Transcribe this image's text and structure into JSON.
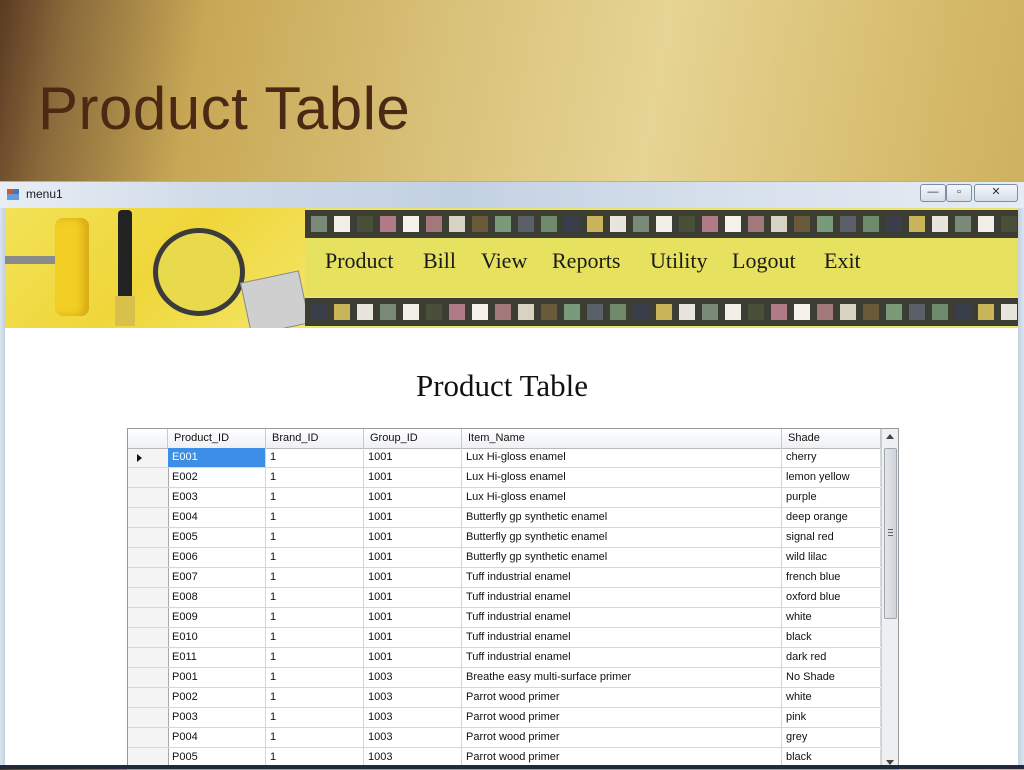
{
  "slide": {
    "title": "Product Table"
  },
  "window": {
    "title": "menu1",
    "controls": {
      "minimize": "—",
      "maximize": "▫",
      "close": "✕"
    }
  },
  "menu": {
    "items": [
      {
        "label": "Product"
      },
      {
        "label": "Bill"
      },
      {
        "label": "View"
      },
      {
        "label": "Reports"
      },
      {
        "label": "Utility"
      },
      {
        "label": "Logout"
      },
      {
        "label": "Exit"
      }
    ]
  },
  "form": {
    "title": "Product Table"
  },
  "table": {
    "columns": [
      "Product_ID",
      "Brand_ID",
      "Group_ID",
      "Item_Name",
      "Shade"
    ],
    "selected_row": 0,
    "rows": [
      [
        "E001",
        "1",
        "1001",
        "Lux Hi-gloss enamel",
        "cherry"
      ],
      [
        "E002",
        "1",
        "1001",
        "Lux Hi-gloss enamel",
        "lemon yellow"
      ],
      [
        "E003",
        "1",
        "1001",
        "Lux Hi-gloss enamel",
        "purple"
      ],
      [
        "E004",
        "1",
        "1001",
        "Butterfly gp synthetic enamel",
        "deep orange"
      ],
      [
        "E005",
        "1",
        "1001",
        "Butterfly gp synthetic enamel",
        "signal red"
      ],
      [
        "E006",
        "1",
        "1001",
        "Butterfly gp synthetic enamel",
        "wild lilac"
      ],
      [
        "E007",
        "1",
        "1001",
        "Tuff industrial enamel",
        "french blue"
      ],
      [
        "E008",
        "1",
        "1001",
        "Tuff industrial enamel",
        "oxford blue"
      ],
      [
        "E009",
        "1",
        "1001",
        "Tuff industrial enamel",
        "white"
      ],
      [
        "E010",
        "1",
        "1001",
        "Tuff industrial enamel",
        "black"
      ],
      [
        "E011",
        "1",
        "1001",
        "Tuff industrial enamel",
        "dark red"
      ],
      [
        "P001",
        "1",
        "1003",
        "Breathe easy multi-surface primer",
        "No Shade"
      ],
      [
        "P002",
        "1",
        "1003",
        "Parrot wood primer",
        "white"
      ],
      [
        "P003",
        "1",
        "1003",
        "Parrot wood primer",
        "pink"
      ],
      [
        "P004",
        "1",
        "1003",
        "Parrot wood primer",
        "grey"
      ],
      [
        "P005",
        "1",
        "1003",
        "Parrot wood primer",
        "black"
      ]
    ]
  },
  "swatch_colors": [
    "#7b8a78",
    "#a3787a",
    "#6f8a6a",
    "#f2f0e6",
    "#d8d2c2",
    "#3a3e4a",
    "#4a4f3a",
    "#6b5a3a",
    "#c9b45a",
    "#b07a86",
    "#7a9a7a",
    "#e8e6dc",
    "#f4f2ea",
    "#5a5f6a"
  ]
}
